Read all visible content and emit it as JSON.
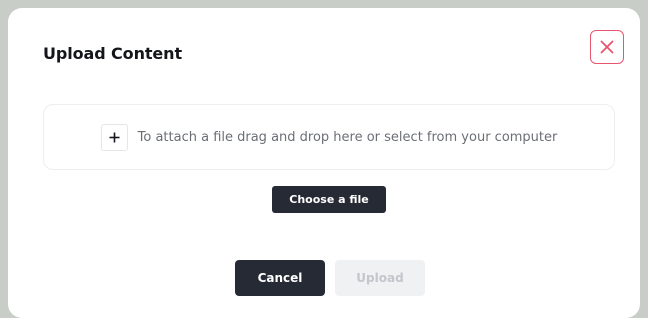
{
  "dialog": {
    "title": "Upload Content",
    "close_icon": "close-icon",
    "accent_color": "#e8556f"
  },
  "dropzone": {
    "plus_icon": "plus-icon",
    "text": "To attach a file drag and drop here or select from your computer"
  },
  "actions": {
    "choose_file_label": "Choose a file",
    "cancel_label": "Cancel",
    "upload_label": "Upload",
    "upload_enabled": false,
    "primary_color": "#262a35",
    "disabled_color": "#f0f1f3"
  }
}
